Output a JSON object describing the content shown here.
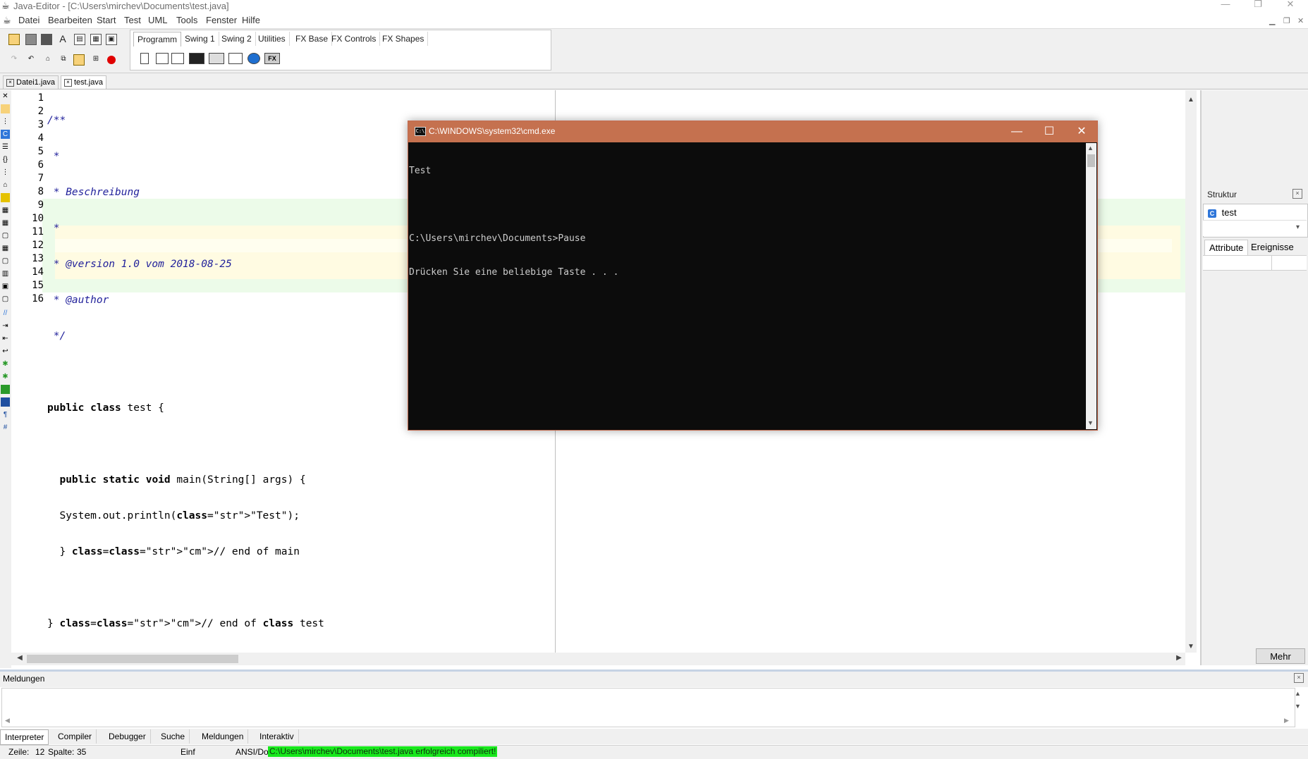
{
  "window": {
    "title": "Java-Editor - [C:\\Users\\mirchev\\Documents\\test.java]"
  },
  "menu": [
    "Datei",
    "Bearbeiten",
    "Start",
    "Test",
    "UML",
    "Tools",
    "Fenster",
    "Hilfe"
  ],
  "palette": {
    "tabs": [
      "Programm",
      "Swing 1",
      "Swing 2",
      "Utilities",
      "FX Base",
      "FX Controls",
      "FX Shapes"
    ],
    "active_tab": "Programm",
    "fx_label": "FX"
  },
  "file_tabs": [
    {
      "label": "Datei1.java",
      "active": false
    },
    {
      "label": "test.java",
      "active": true
    }
  ],
  "editor": {
    "line_numbers": [
      "1",
      "2",
      "3",
      "4",
      "5",
      "6",
      "7",
      "8",
      "9",
      "10",
      "11",
      "12",
      "13",
      "14",
      "15",
      "16"
    ],
    "lines": [
      "/**",
      " *",
      " * Beschreibung",
      " *",
      " * @version 1.0 vom 2018-08-25",
      " * @author",
      " */",
      "",
      "public class test {",
      "",
      "  public static void main(String[] args) {",
      "  System.out.println(\"Test\");",
      "  } // end of main",
      "",
      "} // end of class test",
      ""
    ]
  },
  "structure": {
    "title": "Struktur",
    "class_badge": "C",
    "class_name": "test",
    "tabs": [
      "Attribute",
      "Ereignisse"
    ],
    "more_button": "Mehr"
  },
  "messages": {
    "title": "Meldungen",
    "tabs": [
      "Interpreter",
      "Compiler",
      "Debugger",
      "Suche",
      "Meldungen",
      "Interaktiv"
    ],
    "active_tab": "Interpreter"
  },
  "status": {
    "line_label": "Zeile:",
    "line": "12",
    "col_label": "Spalte:",
    "col": "35",
    "mode": "Einf",
    "encoding": "ANSI/Dos",
    "message": "C:\\Users\\mirchev\\Documents\\test.java erfolgreich compiliert!",
    "message_color": "#18e81c"
  },
  "cmd": {
    "title": "C:\\WINDOWS\\system32\\cmd.exe",
    "icon_text": "C:\\",
    "titlebar_color": "#c5714f",
    "lines": [
      "Test",
      "",
      "C:\\Users\\mirchev\\Documents>Pause",
      "Drücken Sie eine beliebige Taste . . ."
    ]
  }
}
